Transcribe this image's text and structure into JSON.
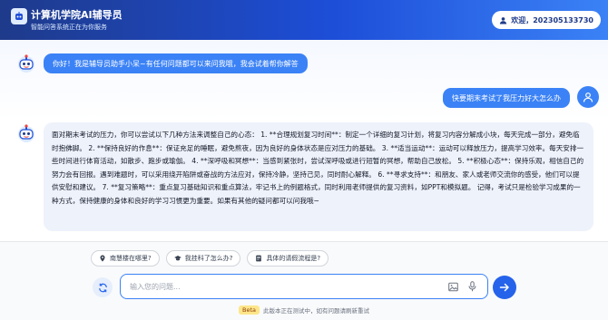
{
  "header": {
    "title": "计算机学院AI辅导员",
    "subtitle": "智能问答系统正在为你服务",
    "user_label": "欢迎，202305133730"
  },
  "chat": {
    "greeting": "你好！我是辅导员助手小呆~有任何问题都可以来问我哦，我会试着帮你解答",
    "user_message": "快要期末考试了我压力好大怎么办",
    "bot_reply": "面对期末考试的压力，你可以尝试以下几种方法来调整自己的心态： 1. **合理规划复习时间**：制定一个详细的复习计划，将复习内容分解成小块，每天完成一部分，避免临时抱佛脚。 2. **保持良好的作息**：保证充足的睡眠，避免熬夜，因为良好的身体状态是应对压力的基础。 3. **适当运动**：运动可以释放压力，提高学习效率。每天安排一些时间进行体育活动，如散步、跑步或瑜伽。 4. **深呼吸和冥想**：当感到紧张时，尝试深呼吸或进行短暂的冥想，帮助自己放松。 5. **积极心态**：保持乐观，相信自己的努力会有回报。遇到难题时，可以采用绕开陷阱或奋战的方法应对，保持冷静，坚持己见，同时耐心解释。 6. **寻求支持**：和朋友、家人或老师交流你的感受，他们可以提供安慰和建议。 7. **复习策略**：重点复习基础知识和重点算法，牢记书上的例题格式，同时利用老师提供的复习资料，如PPT和模拟题。 记得，考试只是检验学习成果的一种方式，保持健康的身体和良好的学习习惯更为重要。如果有其他的疑问都可以问我哦~"
  },
  "suggestions": [
    "南慧楼在哪里?",
    "我挂科了怎么办?",
    "具体的请假流程是?"
  ],
  "input": {
    "placeholder": "输入您的问题...",
    "value": ""
  },
  "footer": {
    "badge": "Beta",
    "note": "此版本正在测试中，如有问题请刷新重试"
  },
  "colors": {
    "primary": "#2563eb",
    "header_start": "#1e3a8a",
    "bubble_blue": "#3b82f6",
    "bubble_gray": "#eef2fb"
  },
  "icons": {
    "logo": "robot-icon",
    "user": "user-icon",
    "location": "location-pin-icon",
    "graduation": "graduation-cap-icon",
    "document": "document-icon",
    "refresh": "refresh-icon",
    "image": "image-icon",
    "mic": "mic-icon",
    "send": "send-arrow-icon"
  }
}
